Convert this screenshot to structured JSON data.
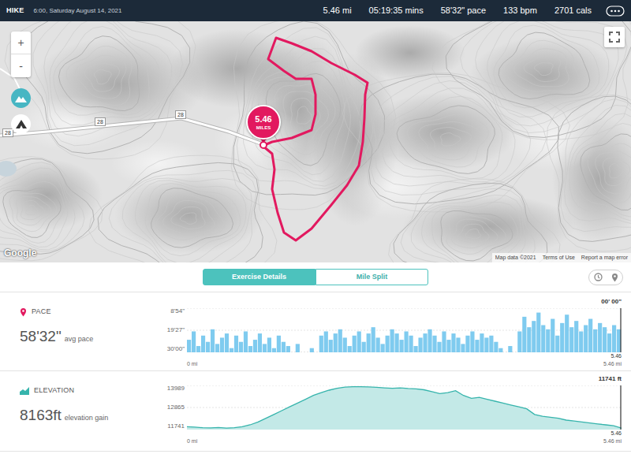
{
  "header": {
    "activity": "HIKE",
    "date": "6:00, Saturday August 14, 2021",
    "stats": [
      "5.46 mi",
      "05:19:35 mins",
      "58'32\" pace",
      "133 bpm",
      "2701 cals"
    ]
  },
  "map": {
    "zoom_in": "+",
    "zoom_out": "-",
    "road_labels": [
      "28",
      "28",
      "28"
    ],
    "marker": {
      "value": "5.46",
      "unit": "MILES"
    },
    "logo": "Google",
    "attribution": [
      "Map data ©2021",
      "Terms of Use",
      "Report a map error"
    ]
  },
  "tabs": [
    {
      "label": "Exercise Details",
      "selected": true
    },
    {
      "label": "Mile Split",
      "selected": false
    }
  ],
  "pace": {
    "title": "PACE",
    "value": "58'32\"",
    "caption": "avg pace",
    "cursor_label": "00' 00\"",
    "ticks": [
      "8'54\"",
      "19'27\"",
      "30'00\""
    ],
    "axis": {
      "min": 8.9,
      "max": 30
    },
    "x_start": "0 mi",
    "x_end": "5.46 mi",
    "cursor_x": "5.46",
    "values": [
      24,
      20,
      27,
      22,
      25,
      19,
      26,
      23,
      21,
      28,
      22,
      25,
      20,
      27,
      24,
      21,
      26,
      23,
      28,
      22,
      25,
      27,
      30,
      26,
      30,
      30,
      28,
      30,
      22,
      20,
      24,
      21,
      19,
      23,
      27,
      22,
      20,
      25,
      21,
      18,
      23,
      26,
      22,
      19,
      21,
      24,
      20,
      22,
      27,
      23,
      21,
      19,
      22,
      25,
      20,
      24,
      21,
      23,
      26,
      22,
      20,
      24,
      21,
      23,
      22,
      25,
      28,
      30,
      27,
      30,
      20,
      13,
      18,
      15,
      11,
      17,
      19,
      14,
      22,
      16,
      12,
      18,
      15,
      20,
      17,
      14,
      19,
      16,
      18,
      21,
      17,
      19
    ]
  },
  "elevation": {
    "title": "ELEVATION",
    "value": "8163ft",
    "caption": "elevation gain",
    "cursor_label": "11741 ft",
    "ticks": [
      "13989",
      "12865",
      "11741"
    ],
    "axis": {
      "min": 11741,
      "max": 13989
    },
    "x_start": "0 mi",
    "x_end": "5.46 mi",
    "cursor_x": "5.46",
    "values": [
      11850,
      11830,
      11800,
      11790,
      11810,
      11780,
      11800,
      11850,
      11950,
      12100,
      12300,
      12500,
      12700,
      12900,
      13100,
      13300,
      13500,
      13650,
      13780,
      13880,
      13940,
      13960,
      13960,
      13950,
      13930,
      13900,
      13880,
      13900,
      13870,
      13850,
      13800,
      13700,
      13600,
      13650,
      13750,
      13500,
      13350,
      13400,
      13300,
      13200,
      13100,
      13000,
      12900,
      12800,
      12500,
      12400,
      12350,
      12300,
      12200,
      12150,
      12100,
      12050,
      12000,
      11950,
      11900,
      11780
    ]
  }
}
